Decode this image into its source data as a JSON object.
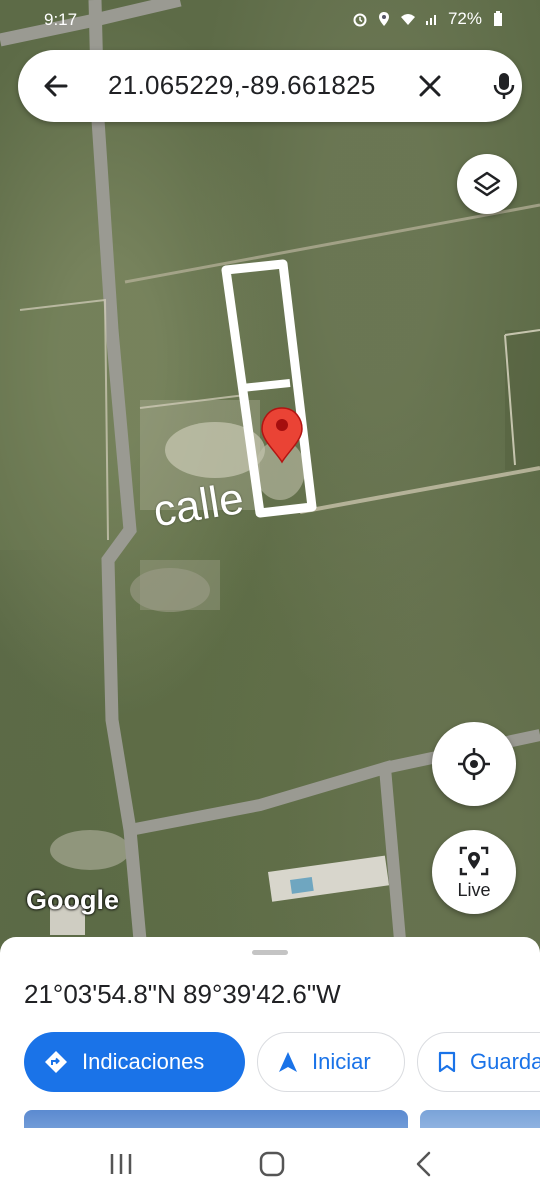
{
  "status_bar": {
    "time": "9:17",
    "battery": "72%"
  },
  "search": {
    "query": "21.065229,-89.661825"
  },
  "map": {
    "annotation": "calle",
    "logo": "Google"
  },
  "buttons": {
    "layers_icon": "layers-icon",
    "locate_icon": "my-location-icon",
    "live_label": "Live"
  },
  "place_sheet": {
    "coordinates": "21°03'54.8\"N 89°39'42.6\"W",
    "actions": {
      "directions_label": "Indicaciones",
      "start_label": "Iniciar",
      "save_label": "Guardar"
    }
  },
  "colors": {
    "accent": "#1a73e8",
    "pin": "#ea4335",
    "outline": "#ffffff"
  }
}
